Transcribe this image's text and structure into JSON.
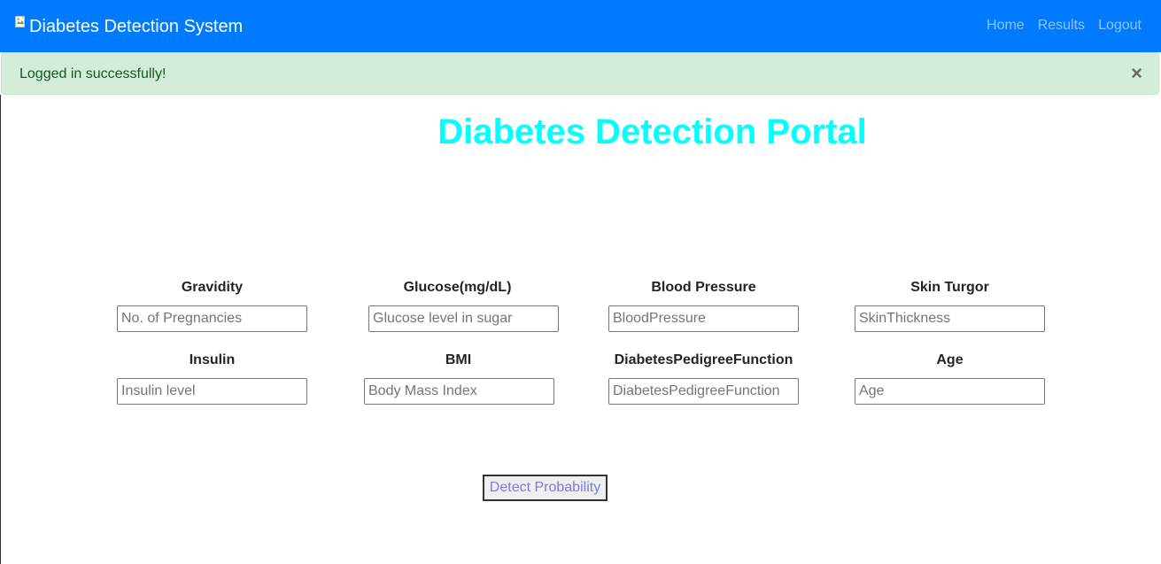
{
  "navbar": {
    "brand": "Diabetes Detection System",
    "links": [
      "Home",
      "Results",
      "Logout"
    ],
    "background": "#007bff"
  },
  "alert": {
    "message": "Logged in successfully!",
    "close": "×",
    "background": "#d4edda"
  },
  "page": {
    "title": "Diabetes Detection Portal",
    "title_color": "#00ffff"
  },
  "form": {
    "fields": [
      {
        "label": "Gravidity",
        "placeholder": "No. of Pregnancies",
        "value": ""
      },
      {
        "label": "Glucose(mg/dL)",
        "placeholder": "Glucose level in sugar",
        "value": ""
      },
      {
        "label": "Blood Pressure",
        "placeholder": "BloodPressure",
        "value": ""
      },
      {
        "label": "Skin Turgor",
        "placeholder": "SkinThickness",
        "value": ""
      },
      {
        "label": "Insulin",
        "placeholder": "Insulin level",
        "value": ""
      },
      {
        "label": "BMI",
        "placeholder": "Body Mass Index",
        "value": ""
      },
      {
        "label": "DiabetesPedigreeFunction",
        "placeholder": "DiabetesPedigreeFunction",
        "value": ""
      },
      {
        "label": "Age",
        "placeholder": "Age",
        "value": ""
      }
    ],
    "submit_label": "Detect Probability"
  }
}
